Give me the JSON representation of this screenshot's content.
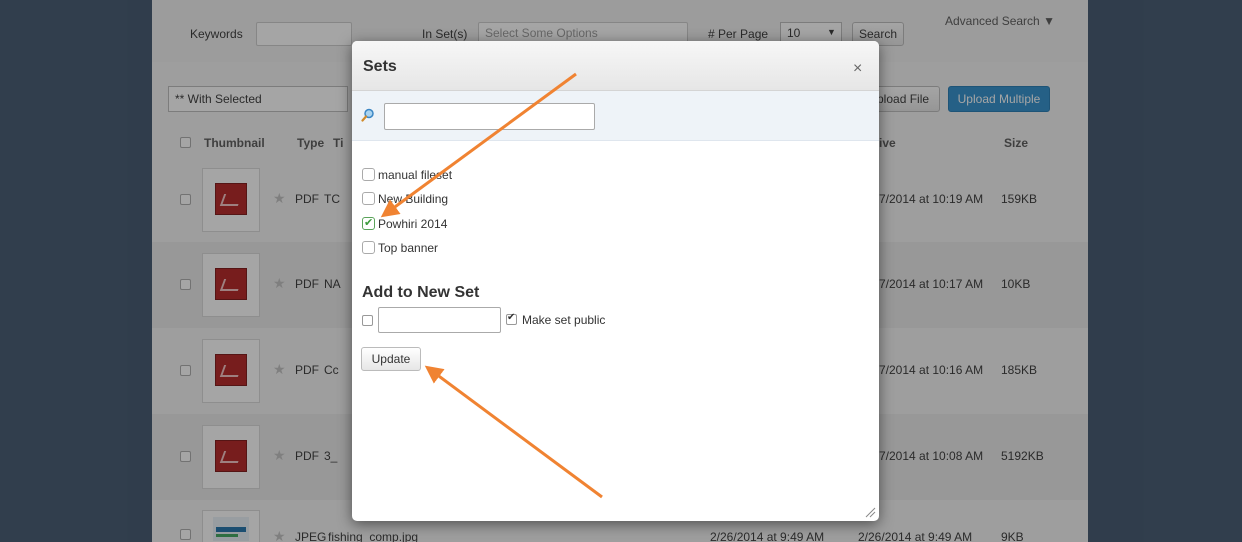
{
  "search": {
    "keywords_label": "Keywords",
    "in_sets_label": "In Set(s)",
    "in_sets_placeholder": "Select Some Options",
    "per_page_label": "# Per Page",
    "per_page_value": "10",
    "per_page_arrow": "▼",
    "search_button": "Search",
    "advanced_search": "Advanced Search ▼"
  },
  "toolbar": {
    "with_selected": "** With Selected",
    "upload_file": "pload File",
    "upload_multiple": "Upload Multiple"
  },
  "table": {
    "headers": {
      "thumbnail": "Thumbnail",
      "type": "Type",
      "title": "Ti",
      "active": "ive",
      "size": "Size"
    },
    "rows": [
      {
        "type": "PDF",
        "title": "TC",
        "active": "7/2014 at 10:19 AM",
        "size": "159KB"
      },
      {
        "type": "PDF",
        "title": "NA",
        "active": "7/2014 at 10:17 AM",
        "size": "10KB"
      },
      {
        "type": "PDF",
        "title": "Cc",
        "active": "7/2014 at 10:16 AM",
        "size": "185KB"
      },
      {
        "type": "PDF",
        "title": "3_",
        "active": "7/2014 at 10:08 AM",
        "size": "5192KB"
      },
      {
        "type": "JPEG",
        "title": "fishing_comp.jpg",
        "added": "2/26/2014 at 9:49 AM",
        "active": "2/26/2014 at 9:49 AM",
        "size": "9KB"
      }
    ]
  },
  "modal": {
    "title": "Sets",
    "close": "×",
    "sets": [
      {
        "label": "manual fileset",
        "checked": false
      },
      {
        "label": "New Building",
        "checked": false
      },
      {
        "label": "Powhiri 2014",
        "checked": true
      },
      {
        "label": "Top banner",
        "checked": false
      }
    ],
    "new_set_title": "Add to New Set",
    "make_public_label": "Make set public",
    "update_button": "Update"
  },
  "colors": {
    "accent": "#2a8ccb",
    "arrow": "#f08332",
    "overlay": "rgba(30,30,30,0.40)"
  }
}
